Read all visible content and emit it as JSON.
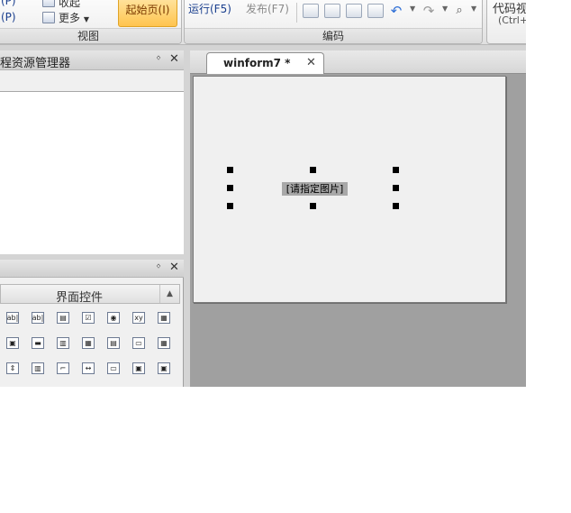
{
  "ribbon": {
    "group_view": {
      "label": "视图",
      "item_left_top": "(P)",
      "item_left_mid": "(P)",
      "item_options": "收起",
      "item_more": "更多",
      "start_page": "起始页(I)"
    },
    "group_code": {
      "label": "编码",
      "run": "运行(F5)",
      "publish": "发布(F7)"
    },
    "group_codeview": {
      "label": "代码视",
      "shortcut": "(Ctrl+"
    }
  },
  "explorer_panel": {
    "title": "程资源管理器"
  },
  "toolbox_panel": {
    "category": "界面控件",
    "tools": [
      [
        "ab|",
        "ab|",
        "▤",
        "☑",
        "◉",
        "xy",
        "▦"
      ],
      [
        "▣",
        "▬",
        "▥",
        "▦",
        "▤",
        "▭",
        "▦"
      ],
      [
        "⇕",
        "▥",
        "⌐",
        "↔",
        "▭",
        "▣",
        "▣"
      ]
    ]
  },
  "document": {
    "tab_title": "winform7 *",
    "picture_placeholder": "[请指定图片]"
  },
  "colors": {
    "accent_orange": "#ffc44f",
    "canvas_bg": "#f0f0f0",
    "workspace_bg": "#a0a0a0"
  }
}
